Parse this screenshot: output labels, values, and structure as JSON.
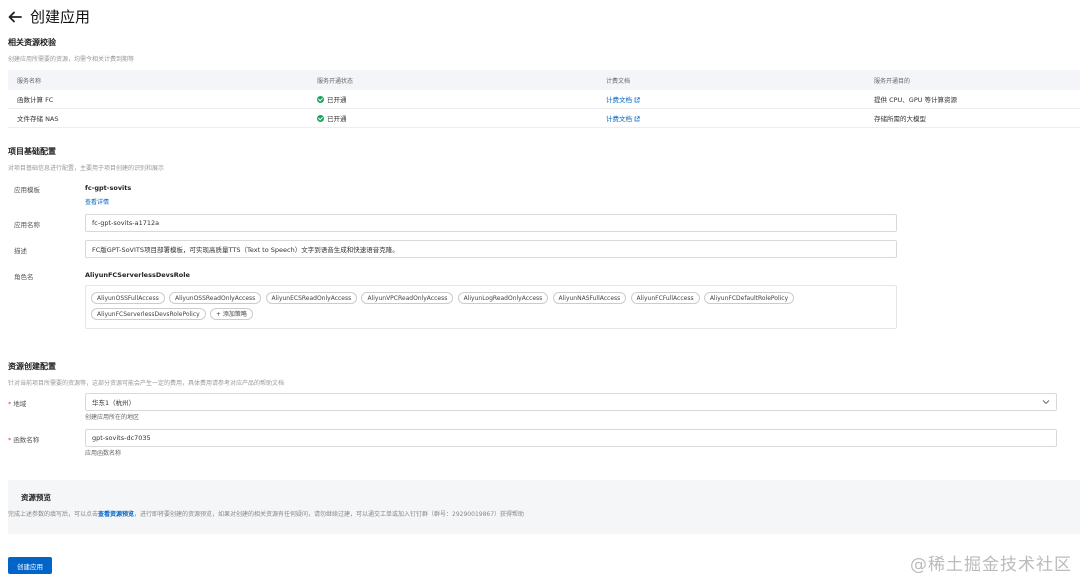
{
  "header": {
    "title": "创建应用"
  },
  "related": {
    "title": "相关资源校验",
    "desc": "创建应用所需要的资源，均需今相关计费到期等",
    "columns": [
      "服务名称",
      "服务开通状态",
      "计费文档",
      "服务开通目的"
    ],
    "rows": [
      {
        "name": "函数计算 FC",
        "status": "已开通",
        "doc": "计费文档",
        "purpose": "提供 CPU、GPU 等计算资源"
      },
      {
        "name": "文件存储 NAS",
        "status": "已开通",
        "doc": "计费文档",
        "purpose": "存储所需的大模型"
      }
    ]
  },
  "basic": {
    "title": "项目基础配置",
    "desc": "对项目基础信息进行配置，主要用于项目创建的识别和展示",
    "template_label": "应用模板",
    "template_value": "fc-gpt-sovits",
    "template_link": "查看详情",
    "app_name_label": "应用名称",
    "app_name_value": "fc-gpt-sovits-a1712a",
    "desc_label": "描述",
    "desc_value": "FC版GPT-SoVITS项目部署模板，可实现高质量TTS（Text to Speech）文字到语音生成和快速语音克隆。",
    "role_label": "角色名",
    "role_value": "AliyunFCServerlessDevsRole",
    "policies": [
      "AliyunOSSFullAccess",
      "AliyunOSSReadOnlyAccess",
      "AliyunECSReadOnlyAccess",
      "AliyunVPCReadOnlyAccess",
      "AliyunLogReadOnlyAccess",
      "AliyunNASFullAccess",
      "AliyunFCFullAccess",
      "AliyunFCDefaultRolePolicy",
      "AliyunFCServerlessDevsRolePolicy"
    ],
    "add_policy": "+ 添加策略"
  },
  "resource": {
    "title": "资源创建配置",
    "desc": "针对当前项目所需要的资源等，这部分资源可能会产生一定的费用，具体费用请参考对应产品的帮助文档",
    "region_label": "地域",
    "region_value": "华东1（杭州）",
    "region_help": "创建应用所在的地区",
    "fn_label": "函数名称",
    "fn_value": "gpt-sovits-dc7035",
    "fn_help": "应用函数名称"
  },
  "preview": {
    "title": "资源预览",
    "text_before": "完成上述参数的填写后，可以点击",
    "link": "查看资源预览",
    "text_after": "，进行即将要创建的资源预览，如果对创建的相关资源有任何疑问，请勿继续过建，可以通交工单或加入钉钉群（群号：29290019867）获得帮助"
  },
  "submit": {
    "label": "创建应用"
  },
  "watermark": "@稀土掘金技术社区"
}
